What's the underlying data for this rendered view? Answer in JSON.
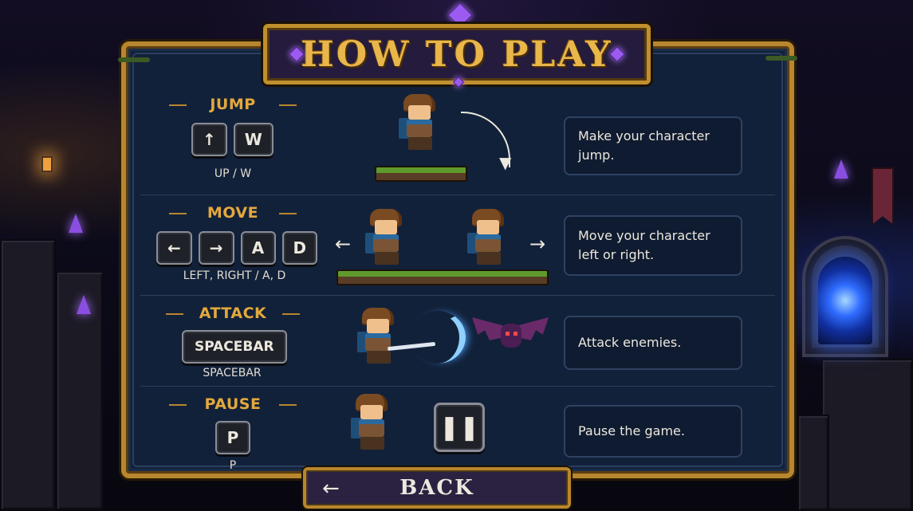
{
  "title": "HOW TO PLAY",
  "controls": [
    {
      "action": "JUMP",
      "keys": [
        {
          "label": "↑",
          "icon": "arrow-up-icon"
        },
        {
          "label": "W"
        }
      ],
      "caption": "UP / W",
      "description": "Make your character jump."
    },
    {
      "action": "MOVE",
      "keys": [
        {
          "label": "←",
          "icon": "arrow-left-icon"
        },
        {
          "label": "→",
          "icon": "arrow-right-icon"
        },
        {
          "label": "A"
        },
        {
          "label": "D"
        }
      ],
      "caption": "LEFT, RIGHT / A, D",
      "description": "Move your character left or right."
    },
    {
      "action": "ATTACK",
      "keys": [
        {
          "label": "SPACEBAR"
        }
      ],
      "caption": "SPACEBAR",
      "description": "Attack enemies."
    },
    {
      "action": "PAUSE",
      "keys": [
        {
          "label": "P"
        }
      ],
      "caption": "P",
      "description": "Pause the game."
    }
  ],
  "move_arrows": {
    "left": "←",
    "right": "→"
  },
  "pause_symbol": "❚❚",
  "back_button": {
    "label": "BACK",
    "arrow": "←"
  },
  "colors": {
    "gold": "#e3a83c",
    "panel": "#12213a",
    "crystal": "#8a4ee0",
    "portal": "#2f6cff"
  }
}
